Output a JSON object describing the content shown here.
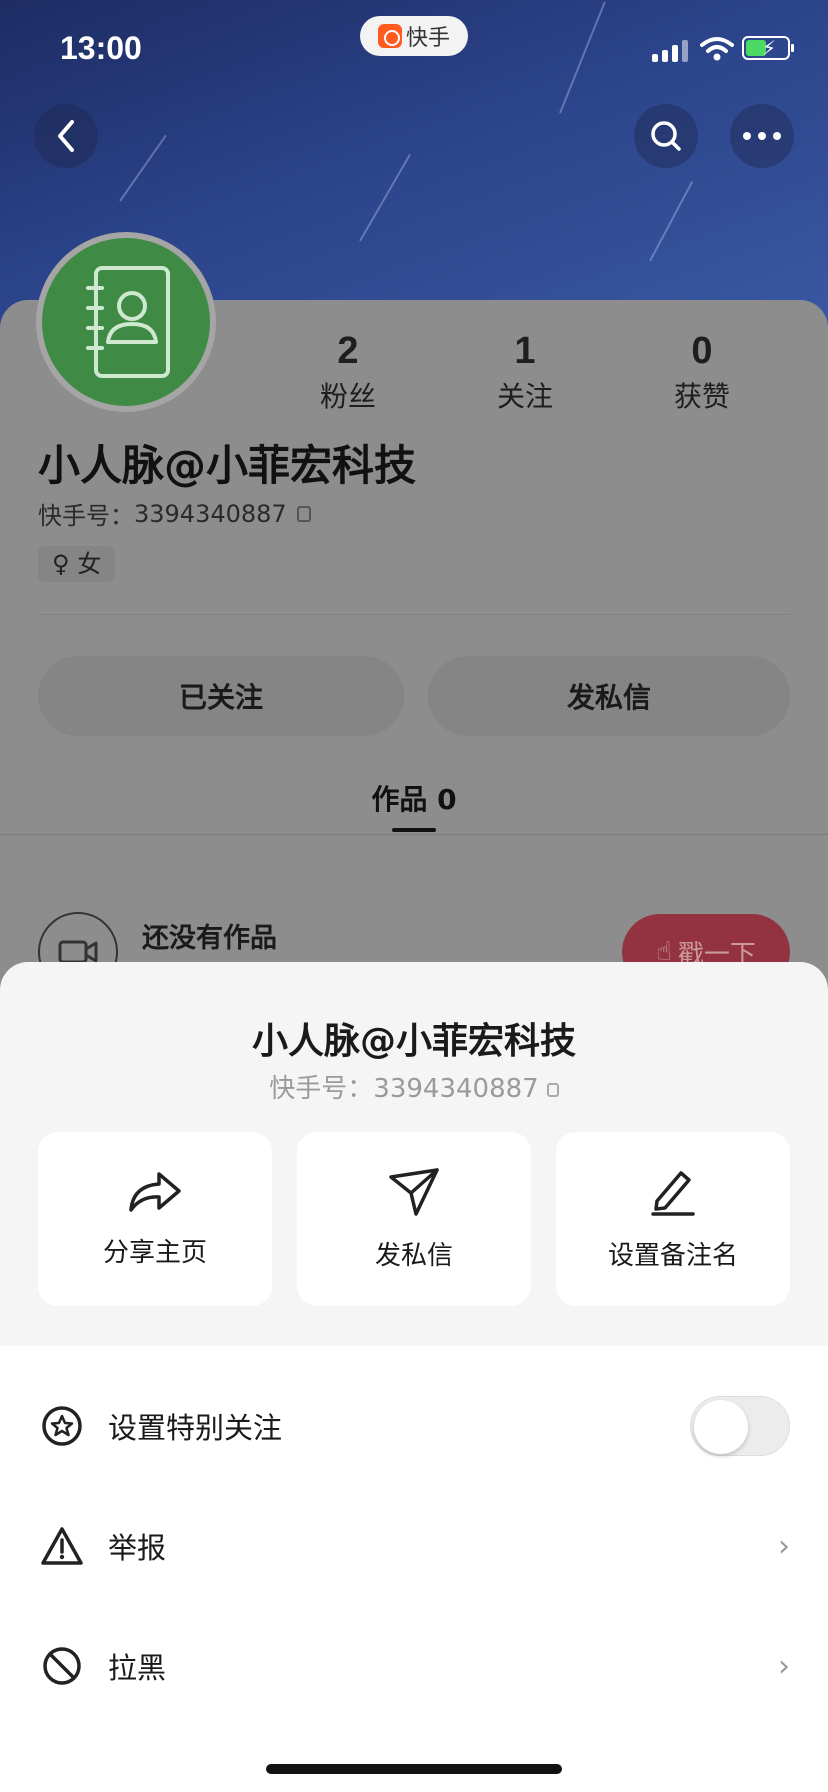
{
  "status_bar": {
    "time": "13:00",
    "app_badge": "快手"
  },
  "nav": {
    "back_icon": "chevron-left-icon",
    "search_icon": "search-icon",
    "more_icon": "more-icon"
  },
  "profile": {
    "nickname": "小人脉@小菲宏科技",
    "kuaishou_id_label": "快手号：",
    "kuaishou_id": "3394340887",
    "gender": "女",
    "stats": [
      {
        "num": "2",
        "label": "粉丝"
      },
      {
        "num": "1",
        "label": "关注"
      },
      {
        "num": "0",
        "label": "获赞"
      }
    ],
    "follow_btn": "已关注",
    "message_btn": "发私信",
    "works_tab": "作品 0",
    "empty_text": "还没有作品",
    "poke_btn": "戳一下"
  },
  "sheet": {
    "name": "小人脉@小菲宏科技",
    "id_label": "快手号：",
    "id": "3394340887",
    "actions": [
      {
        "label": "分享主页",
        "icon": "share-icon"
      },
      {
        "label": "发私信",
        "icon": "send-icon"
      },
      {
        "label": "设置备注名",
        "icon": "edit-icon"
      }
    ],
    "rows": [
      {
        "label": "设置特别关注",
        "icon": "star-circle-icon",
        "toggle_on": false
      },
      {
        "label": "举报",
        "icon": "warning-icon"
      },
      {
        "label": "拉黑",
        "icon": "block-icon"
      }
    ]
  },
  "colors": {
    "accent_red": "#fe3666",
    "avatar_green": "#3f8a45"
  }
}
